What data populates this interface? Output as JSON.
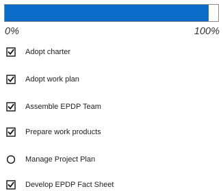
{
  "progress": {
    "fraction": 0.955,
    "fill_color": "#0a6bc8",
    "min_label": "0%",
    "max_label": "100%"
  },
  "tasks": [
    {
      "label": "Adopt charter",
      "done": true,
      "icon": "checked-box-icon"
    },
    {
      "label": "Adopt work plan",
      "done": true,
      "icon": "checked-box-icon"
    },
    {
      "label": "Assemble EPDP Team",
      "done": true,
      "icon": "checked-box-icon"
    },
    {
      "label": "Prepare work products",
      "done": true,
      "icon": "checked-box-icon"
    },
    {
      "label": "Manage Project Plan",
      "done": false,
      "icon": "open-circle-icon"
    },
    {
      "label": "Develop EPDP Fact Sheet",
      "done": true,
      "icon": "checked-box-icon"
    }
  ]
}
